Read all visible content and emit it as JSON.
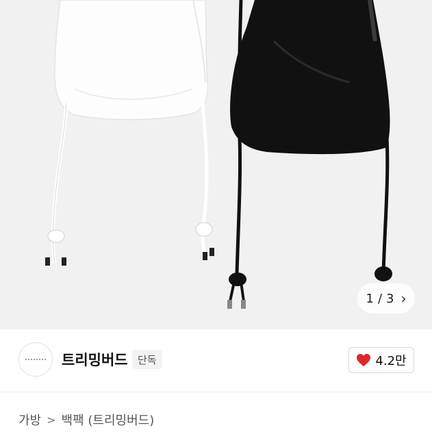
{
  "gallery": {
    "current": "1",
    "separator": "/",
    "total": "3",
    "next_icon": "chevron-right-icon"
  },
  "store": {
    "name": "트리밍버드",
    "badge": "단독",
    "logo_icon": "store-logo"
  },
  "like": {
    "icon": "heart-icon",
    "count": "4.2만",
    "color": "#e0262c"
  },
  "breadcrumb": {
    "items": [
      "가방",
      "백팩 (트리밍버드)"
    ],
    "separator_icon": "chevron-right-icon"
  }
}
